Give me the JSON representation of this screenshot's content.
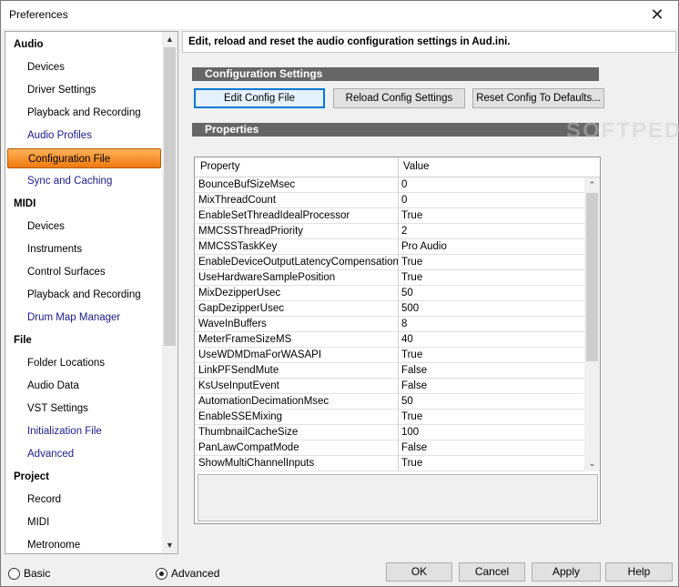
{
  "window": {
    "title": "Preferences"
  },
  "nav": {
    "items": [
      {
        "label": "Audio",
        "kind": "header"
      },
      {
        "label": "Devices",
        "kind": "child"
      },
      {
        "label": "Driver Settings",
        "kind": "child"
      },
      {
        "label": "Playback and Recording",
        "kind": "child"
      },
      {
        "label": "Audio Profiles",
        "kind": "child-blue"
      },
      {
        "label": "Configuration File",
        "kind": "selected"
      },
      {
        "label": "Sync and Caching",
        "kind": "child-blue"
      },
      {
        "label": "MIDI",
        "kind": "header"
      },
      {
        "label": "Devices",
        "kind": "child"
      },
      {
        "label": "Instruments",
        "kind": "child"
      },
      {
        "label": "Control Surfaces",
        "kind": "child"
      },
      {
        "label": "Playback and Recording",
        "kind": "child"
      },
      {
        "label": "Drum Map Manager",
        "kind": "child-blue"
      },
      {
        "label": "File",
        "kind": "header"
      },
      {
        "label": "Folder Locations",
        "kind": "child"
      },
      {
        "label": "Audio Data",
        "kind": "child"
      },
      {
        "label": "VST Settings",
        "kind": "child"
      },
      {
        "label": "Initialization File",
        "kind": "child-blue"
      },
      {
        "label": "Advanced",
        "kind": "child-blue"
      },
      {
        "label": "Project",
        "kind": "header"
      },
      {
        "label": "Record",
        "kind": "child"
      },
      {
        "label": "MIDI",
        "kind": "child"
      },
      {
        "label": "Metronome",
        "kind": "child"
      }
    ]
  },
  "panel": {
    "description": "Edit, reload and reset the audio configuration settings in Aud.ini.",
    "config_section": "Configuration Settings",
    "properties_section": "Properties",
    "buttons": {
      "edit": "Edit Config File",
      "reload": "Reload Config Settings",
      "reset": "Reset Config To Defaults..."
    },
    "watermark": "SOFTPEDIA"
  },
  "grid": {
    "headers": {
      "property": "Property",
      "value": "Value"
    },
    "rows": [
      {
        "property": "BounceBufSizeMsec",
        "value": "0"
      },
      {
        "property": "MixThreadCount",
        "value": "0"
      },
      {
        "property": "EnableSetThreadIdealProcessor",
        "value": "True"
      },
      {
        "property": "MMCSSThreadPriority",
        "value": "2"
      },
      {
        "property": "MMCSSTaskKey",
        "value": "Pro Audio"
      },
      {
        "property": "EnableDeviceOutputLatencyCompensation",
        "value": "True"
      },
      {
        "property": "UseHardwareSamplePosition",
        "value": "True"
      },
      {
        "property": "MixDezipperUsec",
        "value": "50"
      },
      {
        "property": "GapDezipperUsec",
        "value": "500"
      },
      {
        "property": "WaveInBuffers",
        "value": "8"
      },
      {
        "property": "MeterFrameSizeMS",
        "value": "40"
      },
      {
        "property": "UseWDMDmaForWASAPI",
        "value": "True"
      },
      {
        "property": "LinkPFSendMute",
        "value": "False"
      },
      {
        "property": "KsUseInputEvent",
        "value": "False"
      },
      {
        "property": "AutomationDecimationMsec",
        "value": "50"
      },
      {
        "property": "EnableSSEMixing",
        "value": "True"
      },
      {
        "property": "ThumbnailCacheSize",
        "value": "100"
      },
      {
        "property": "PanLawCompatMode",
        "value": "False"
      },
      {
        "property": "ShowMultiChannelInputs",
        "value": "True"
      }
    ]
  },
  "bottom": {
    "basic": "Basic",
    "advanced": "Advanced",
    "ok": "OK",
    "cancel": "Cancel",
    "apply": "Apply",
    "help": "Help"
  }
}
